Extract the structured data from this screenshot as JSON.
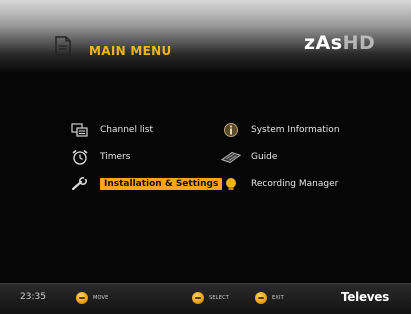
{
  "header": {
    "title": "MAIN MENU",
    "logo_bold": "zAs",
    "logo_light": "HD"
  },
  "menu": {
    "left": [
      {
        "label": "Channel list",
        "icon": "channel-list-icon"
      },
      {
        "label": "Timers",
        "icon": "alarm-clock-icon"
      },
      {
        "label": "Installation & Settings",
        "icon": "wrench-icon",
        "selected": true
      }
    ],
    "right": [
      {
        "label": "System Information",
        "icon": "info-icon"
      },
      {
        "label": "Guide",
        "icon": "guide-icon"
      },
      {
        "label": "Recording Manager",
        "icon": "recording-icon"
      }
    ]
  },
  "footer": {
    "time": "23:35",
    "keys": [
      {
        "label": "MOVE"
      },
      {
        "label": "SELECT"
      },
      {
        "label": "EXIT"
      }
    ],
    "brand": "Televes"
  },
  "colors": {
    "accent": "#f0b51c",
    "selection": "#f5a812",
    "background": "#060606"
  }
}
